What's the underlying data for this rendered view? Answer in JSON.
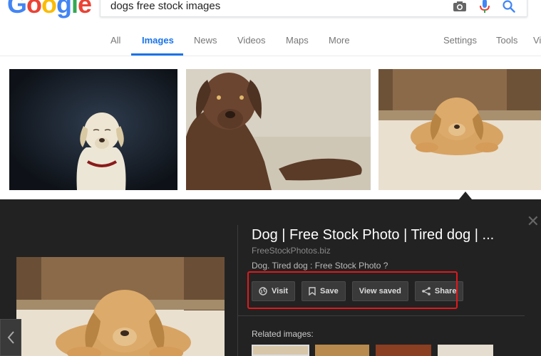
{
  "logo": {
    "text": "Google"
  },
  "search": {
    "query": "dogs free stock images",
    "icons": [
      "camera-icon",
      "microphone-icon",
      "search-icon"
    ]
  },
  "tabs": {
    "all": "All",
    "images": "Images",
    "news": "News",
    "videos": "Videos",
    "maps": "Maps",
    "more": "More",
    "settings": "Settings",
    "tools": "Tools",
    "view_saved_partial": "Vi"
  },
  "colors": {
    "accent": "#1a73e8",
    "panel_bg": "#222222",
    "highlight": "#e0191c"
  },
  "preview": {
    "title": "Dog | Free Stock Photo | Tired dog | ...",
    "domain": "FreeStockPhotos.biz",
    "description": "Dog. Tired dog : Free Stock Photo ?",
    "actions": {
      "visit": "Visit",
      "save": "Save",
      "view_saved": "View saved",
      "share": "Share"
    },
    "related_label": "Related images:"
  }
}
